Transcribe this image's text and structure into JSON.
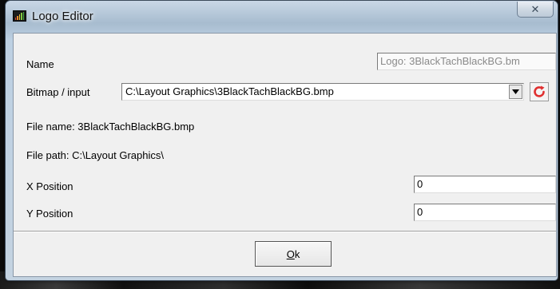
{
  "window": {
    "title": "Logo Editor",
    "close_glyph": "✕"
  },
  "form": {
    "name_label": "Name",
    "name_value": "Logo: 3BlackTachBlackBG.bm",
    "bitmap_label": "Bitmap / input",
    "bitmap_value": "C:\\Layout Graphics\\3BlackTachBlackBG.bmp",
    "file_name_text": "File name: 3BlackTachBlackBG.bmp",
    "file_path_text": "File path: C:\\Layout Graphics\\",
    "x_label": "X Position",
    "x_value": "0",
    "y_label": "Y Position",
    "y_value": "0"
  },
  "footer": {
    "ok_label": "Ok",
    "ok_mnemonic": "O"
  },
  "icons": {
    "app": "bar-chart-icon",
    "dropdown": "chevron-down-icon",
    "refresh": "refresh-icon"
  },
  "colors": {
    "refresh": "#e03030",
    "disabled_text": "#8a8a8a"
  }
}
